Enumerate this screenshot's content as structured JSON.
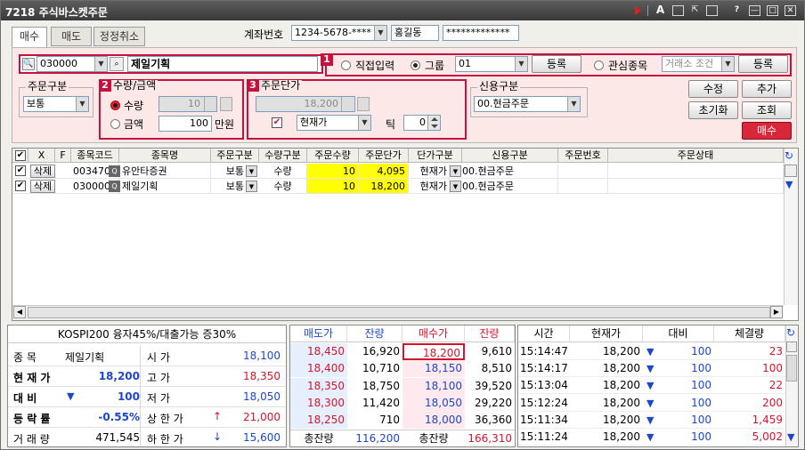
{
  "window": {
    "screen_no": "7218",
    "title": "주식바스켓주문"
  },
  "tabs": [
    {
      "label": "매수"
    },
    {
      "label": "매도"
    },
    {
      "label": "정정취소"
    }
  ],
  "account": {
    "label": "계좌번호",
    "number": "1234-5678-****",
    "name": "홍길동",
    "password": "*************"
  },
  "search": {
    "code": "030000",
    "name": "제일기획"
  },
  "section1": {
    "badge": "1",
    "opt_direct": "직접입력",
    "opt_group": "그룹",
    "group_value": "01",
    "register1": "등록",
    "opt_watch": "관심종목",
    "watch_value": "거래소 조건",
    "register2": "등록"
  },
  "order_type": {
    "legend": "주문구분",
    "value": "보통"
  },
  "section2": {
    "badge": "2",
    "legend": "수량/금액",
    "qty_label": "수량",
    "qty_value": "10",
    "amt_label": "금액",
    "amt_value": "100",
    "amt_unit": "만원"
  },
  "section3": {
    "badge": "3",
    "legend": "주문단가",
    "price_value": "18,200",
    "price_type": "현재가",
    "tick_label": "틱",
    "tick_value": "0"
  },
  "credit": {
    "legend": "신용구분",
    "value": "00.현금주문"
  },
  "actions": {
    "modify": "수정",
    "add": "추가",
    "reset": "초기화",
    "query": "조회",
    "buy": "매수"
  },
  "grid": {
    "headers": [
      "X",
      "F",
      "종목코드",
      "종목명",
      "주문구분",
      "수량구분",
      "주문수량",
      "주문단가",
      "단가구분",
      "신용구분",
      "주문번호",
      "주문상태"
    ],
    "rows": [
      {
        "del": "삭제",
        "code": "003470",
        "name": "유안타증권",
        "order_type": "보통",
        "qty_type": "수량",
        "qty": "10",
        "price": "4,095",
        "price_type": "현재가",
        "credit": "00.현금주문",
        "order_no": "",
        "status": ""
      },
      {
        "del": "삭제",
        "code": "030000",
        "name": "제일기획",
        "order_type": "보통",
        "qty_type": "수량",
        "qty": "10",
        "price": "18,200",
        "price_type": "현재가",
        "credit": "00.현금주문",
        "order_no": "",
        "status": ""
      }
    ]
  },
  "quote": {
    "margin_info": "KOSPI200 융자45%/대출가능 증30%",
    "rows": [
      {
        "l1": "종   목",
        "v1": "제일기획",
        "l2": "시   가",
        "v2": "18,100"
      },
      {
        "l1": "현 재 가",
        "v1": "18,200",
        "l2": "고   가",
        "v2": "18,350"
      },
      {
        "l1": "대   비",
        "v1": "100",
        "l2": "저   가",
        "v2": "18,050"
      },
      {
        "l1": "등 락 률",
        "v1": "-0.55%",
        "l2": "상 한 가",
        "v2": "21,000"
      },
      {
        "l1": "거 래 량",
        "v1": "471,545",
        "l2": "하 한 가",
        "v2": "15,600"
      }
    ]
  },
  "orderbook": {
    "headers": [
      "매도가",
      "잔량",
      "매수가",
      "잔량"
    ],
    "asks": [
      {
        "price": "18,450",
        "qty": "16,920"
      },
      {
        "price": "18,400",
        "qty": "10,710"
      },
      {
        "price": "18,350",
        "qty": "18,750"
      },
      {
        "price": "18,300",
        "qty": "11,420"
      },
      {
        "price": "18,250",
        "qty": "710"
      }
    ],
    "bids": [
      {
        "price": "18,200",
        "qty": "9,610"
      },
      {
        "price": "18,150",
        "qty": "8,510"
      },
      {
        "price": "18,100",
        "qty": "39,520"
      },
      {
        "price": "18,050",
        "qty": "29,220"
      },
      {
        "price": "18,000",
        "qty": "36,360"
      }
    ],
    "total_ask_label": "총잔량",
    "total_ask": "116,200",
    "total_bid_label": "총잔량",
    "total_bid": "166,310"
  },
  "ticks": {
    "headers": [
      "시간",
      "현재가",
      "대비",
      "체결량"
    ],
    "rows": [
      {
        "time": "15:14:47",
        "price": "18,200",
        "diff": "100",
        "vol": "23"
      },
      {
        "time": "15:14:17",
        "price": "18,200",
        "diff": "100",
        "vol": "100"
      },
      {
        "time": "15:13:04",
        "price": "18,200",
        "diff": "100",
        "vol": "22"
      },
      {
        "time": "15:12:24",
        "price": "18,200",
        "diff": "100",
        "vol": "200"
      },
      {
        "time": "15:11:34",
        "price": "18,200",
        "diff": "100",
        "vol": "1,459"
      },
      {
        "time": "15:11:24",
        "price": "18,200",
        "diff": "100",
        "vol": "5,002"
      }
    ]
  }
}
